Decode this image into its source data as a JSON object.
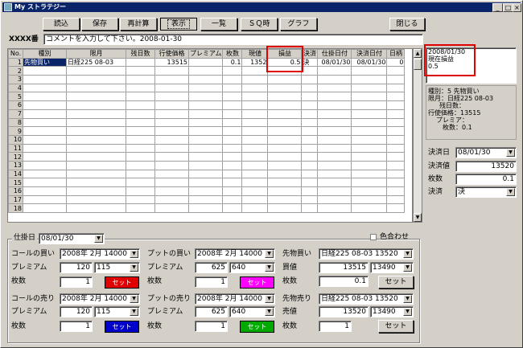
{
  "window": {
    "title": "My ストラテジー",
    "min": "_",
    "max": "□",
    "close": "×"
  },
  "toolbar": {
    "b1": "読込",
    "b2": "保存",
    "b3": "再計算",
    "b4": "表示",
    "b5": "一覧",
    "b6": "ＳＱ時",
    "b7": "グラフ",
    "close": "閉じる"
  },
  "header": {
    "id_label": "XXXX番",
    "comment": "コメントを入力して下さい。2008-01-30"
  },
  "grid": {
    "columns": [
      "No.",
      "種別",
      "限月",
      "残日数",
      "行使価格",
      "プレミアム",
      "枚数",
      "現値",
      "損益",
      "決済",
      "仕掛日付",
      "決済日付",
      "日柄"
    ],
    "row1": {
      "no": "1",
      "kind": "先物買い",
      "month": "日経225 08-03",
      "days": "",
      "strike": "13515",
      "premium": "",
      "qty": "0.1",
      "current": "1352",
      "pl": "0.5",
      "settle": "決",
      "open_date": "08/01/30",
      "close_date": "08/01/30",
      "span": "0"
    },
    "row_numbers": [
      "2",
      "3",
      "4",
      "5",
      "6",
      "7",
      "8",
      "9",
      "10",
      "11",
      "12",
      "13",
      "14",
      "15",
      "16",
      "17",
      "18"
    ]
  },
  "info_box": {
    "l1": "2008/01/30",
    "l2": "現在損益",
    "l3": "0.5"
  },
  "detail": {
    "l1": "種別：5 先物買い",
    "l2": "限月：日経225 08-03",
    "l3": "残日数：",
    "l4": "行使価格：13515",
    "l5": "プレミア：",
    "l6": "枚数：0.1"
  },
  "settlement": {
    "date_label": "決済日",
    "date": "08/01/30",
    "price_label": "決済値",
    "price": "13520",
    "qty_label": "枚数",
    "qty": "0.1",
    "method_label": "決済",
    "method": "決"
  },
  "bottom": {
    "open_date_label": "仕掛日",
    "open_date": "08/01/30",
    "color_label": "色合わせ",
    "call_buy": {
      "label": "コールの買い",
      "month": "2008年 2月 14000",
      "prem_label": "プレミアム",
      "prem": "120",
      "strike": "115",
      "qty_label": "枚数",
      "qty": "1",
      "set": "セット"
    },
    "put_buy": {
      "label": "プットの買い",
      "month": "2008年 2月 14000",
      "prem_label": "プレミアム",
      "prem": "625",
      "strike": "640",
      "qty_label": "枚数",
      "qty": "1",
      "set": "セット"
    },
    "fut_buy": {
      "label": "先物買い",
      "month": "日経225 08-03 13520",
      "price_label": "買値",
      "price": "13515",
      "combo": "13490",
      "qty_label": "枚数",
      "qty": "0.1",
      "set": "セット"
    },
    "call_sell": {
      "label": "コールの売り",
      "month": "2008年 2月 14000",
      "prem_label": "プレミアム",
      "prem": "120",
      "strike": "115",
      "qty_label": "枚数",
      "qty": "1",
      "set": "セット"
    },
    "put_sell": {
      "label": "プットの売り",
      "month": "2008年 2月 14000",
      "prem_label": "プレミアム",
      "prem": "625",
      "strike": "640",
      "qty_label": "枚数",
      "qty": "1",
      "set": "セット"
    },
    "fut_sell": {
      "label": "先物売り",
      "month": "日経225 08-03 13520",
      "price_label": "売値",
      "price": "13520",
      "combo": "13490",
      "qty_label": "枚数",
      "qty": "1",
      "set": "セット"
    }
  },
  "colors": {
    "red": "#e00000",
    "magenta": "#ff00ff",
    "blue": "#0000cc",
    "green": "#00aa00",
    "title": "#0a246a"
  }
}
